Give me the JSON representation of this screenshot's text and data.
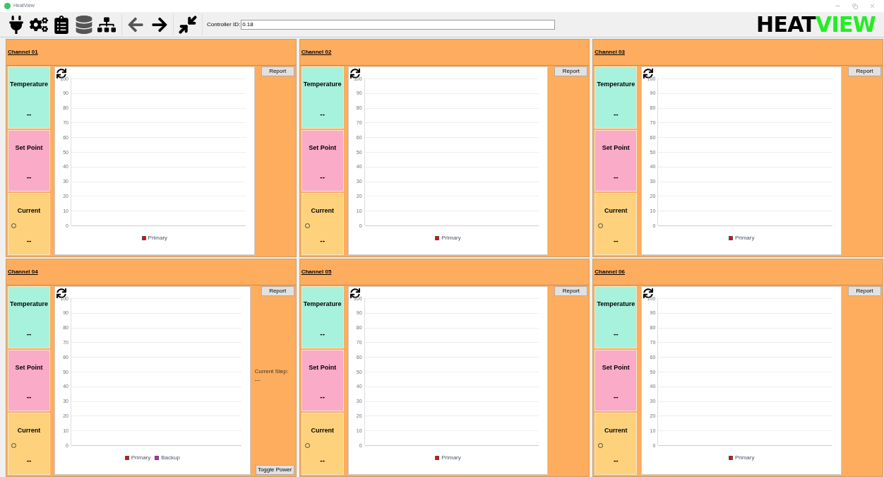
{
  "window": {
    "title": "HeatView"
  },
  "toolbar": {
    "controller_id": {
      "label": "Controller ID:",
      "value": "0.18"
    },
    "logo": [
      {
        "text": "HEAT",
        "color": "#000000"
      },
      {
        "text": "VIEW",
        "color": "#22ee22"
      }
    ]
  },
  "channels": [
    {
      "title": "Channel 01",
      "tiles": [
        {
          "kind": "temperature",
          "label": "Temperature",
          "value": "--"
        },
        {
          "kind": "setpoint",
          "label": "Set Point",
          "value": "--"
        },
        {
          "kind": "current",
          "label": "Current",
          "value": "--"
        }
      ],
      "report": "Report",
      "chart_data": {
        "type": "line",
        "grid": true,
        "ylim": [
          0,
          100
        ],
        "yticks": [
          0,
          10,
          20,
          30,
          40,
          50,
          60,
          70,
          80,
          90,
          100
        ],
        "series": [
          {
            "name": "Primary",
            "color": "#ee0000"
          }
        ]
      }
    },
    {
      "title": "Channel 02",
      "tiles": [
        {
          "kind": "temperature",
          "label": "Temperature",
          "value": "--"
        },
        {
          "kind": "setpoint",
          "label": "Set Point",
          "value": "--"
        },
        {
          "kind": "current",
          "label": "Current",
          "value": "--"
        }
      ],
      "report": "Report",
      "chart_data": {
        "type": "line",
        "grid": true,
        "ylim": [
          0,
          100
        ],
        "yticks": [
          0,
          10,
          20,
          30,
          40,
          50,
          60,
          70,
          80,
          90,
          100
        ],
        "series": [
          {
            "name": "Primary",
            "color": "#ee0000"
          }
        ]
      }
    },
    {
      "title": "Channel 03",
      "tiles": [
        {
          "kind": "temperature",
          "label": "Temperature",
          "value": "--"
        },
        {
          "kind": "setpoint",
          "label": "Set Point",
          "value": "--"
        },
        {
          "kind": "current",
          "label": "Current",
          "value": "--"
        }
      ],
      "report": "Report",
      "chart_data": {
        "type": "line",
        "grid": true,
        "ylim": [
          0,
          100
        ],
        "yticks": [
          0,
          10,
          20,
          30,
          40,
          50,
          60,
          70,
          80,
          90,
          100
        ],
        "series": [
          {
            "name": "Primary",
            "color": "#ee0000"
          }
        ]
      }
    },
    {
      "title": "Channel 04",
      "tiles": [
        {
          "kind": "temperature",
          "label": "Temperature",
          "value": "--"
        },
        {
          "kind": "setpoint",
          "label": "Set Point",
          "value": "--"
        },
        {
          "kind": "current",
          "label": "Current",
          "value": "--"
        }
      ],
      "report": "Report",
      "current_step": {
        "label": "Current Step:",
        "value": "---"
      },
      "toggle": "Toggle Power",
      "chart_data": {
        "type": "line",
        "grid": true,
        "ylim": [
          0,
          100
        ],
        "yticks": [
          0,
          10,
          20,
          30,
          40,
          50,
          60,
          70,
          80,
          90,
          100
        ],
        "series": [
          {
            "name": "Primary",
            "color": "#ee0000"
          },
          {
            "name": "Backup",
            "color": "#ee00ee"
          }
        ]
      }
    },
    {
      "title": "Channel 05",
      "tiles": [
        {
          "kind": "temperature",
          "label": "Temperature",
          "value": "--"
        },
        {
          "kind": "setpoint",
          "label": "Set Point",
          "value": "--"
        },
        {
          "kind": "current",
          "label": "Current",
          "value": "--"
        }
      ],
      "report": "Report",
      "chart_data": {
        "type": "line",
        "grid": true,
        "ylim": [
          0,
          100
        ],
        "yticks": [
          0,
          10,
          20,
          30,
          40,
          50,
          60,
          70,
          80,
          90,
          100
        ],
        "series": [
          {
            "name": "Primary",
            "color": "#ee0000"
          }
        ]
      }
    },
    {
      "title": "Channel 06",
      "tiles": [
        {
          "kind": "temperature",
          "label": "Temperature",
          "value": "--"
        },
        {
          "kind": "setpoint",
          "label": "Set Point",
          "value": "--"
        },
        {
          "kind": "current",
          "label": "Current",
          "value": "--"
        }
      ],
      "report": "Report",
      "chart_data": {
        "type": "line",
        "grid": true,
        "ylim": [
          0,
          100
        ],
        "yticks": [
          0,
          10,
          20,
          30,
          40,
          50,
          60,
          70,
          80,
          90,
          100
        ],
        "series": [
          {
            "name": "Primary",
            "color": "#ee0000"
          }
        ]
      }
    }
  ]
}
